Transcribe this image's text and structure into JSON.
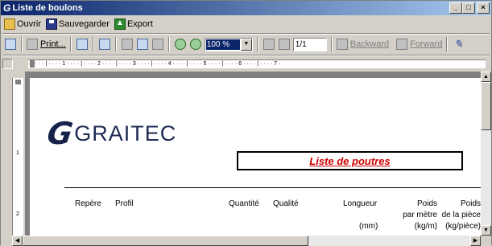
{
  "window": {
    "title": "Liste de boulons",
    "app_icon": "G",
    "min": "_",
    "max": "□",
    "close": "×"
  },
  "menubar": {
    "open": "Ouvrir",
    "save": "Sauvegarder",
    "export": "Export"
  },
  "toolbar": {
    "print": "Print...",
    "zoom": "100 %",
    "page": "1/1",
    "backward": "Backward",
    "forward": "Forward"
  },
  "ruler": {
    "ticks": "· · · · · | · · · · 1 · · · · | · · · · 2 · · · · | · · · · 3 · · · · | · · · · 4 · · · · | · · · · 5 · · · · | · · · · 6 · · · · | · · · · 7 ·"
  },
  "vruler": {
    "marks": [
      "1",
      "2"
    ]
  },
  "report": {
    "logo_mark": "G",
    "logo_text": "GRAITEC",
    "title": "Liste de poutres",
    "columns": {
      "repere": "Repère",
      "profil": "Profil",
      "quantite": "Quantité",
      "qualite": "Qualité",
      "longueur": "Longueur",
      "longueur_unit": "(mm)",
      "poids_metre_1": "Poids",
      "poids_metre_2": "par mètre",
      "poids_metre_3": "(kg/m)",
      "poids_piece_1": "Poids",
      "poids_piece_2": "de la pièce",
      "poids_piece_3": "(kg/pièce)"
    }
  },
  "colors": {
    "title_red": "#cc0000",
    "logo_navy": "#16224a",
    "titlebar": "#0a246a"
  }
}
